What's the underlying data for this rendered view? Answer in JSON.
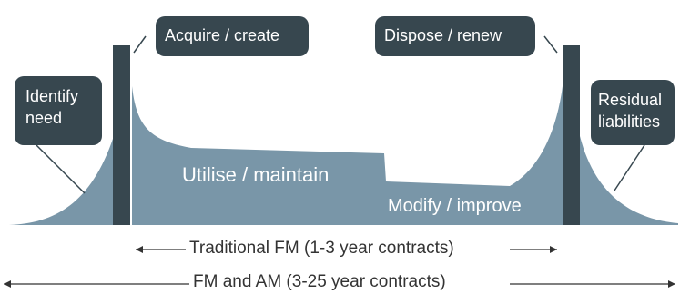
{
  "callouts": {
    "identify": [
      "Identify",
      "need"
    ],
    "acquire": "Acquire / create",
    "dispose": "Dispose / renew",
    "residual": [
      "Residual",
      "liabilities"
    ]
  },
  "phases": {
    "utilise": "Utilise / maintain",
    "modify": "Modify / improve"
  },
  "timelines": {
    "traditional": "Traditional FM (1-3 year contracts)",
    "fm_am": "FM and AM (3-25 year contracts)"
  },
  "colors": {
    "fill": "#7996a8",
    "bar": "#37474f",
    "callout": "#37474f",
    "background": "#ffffff",
    "text": "#333333"
  }
}
